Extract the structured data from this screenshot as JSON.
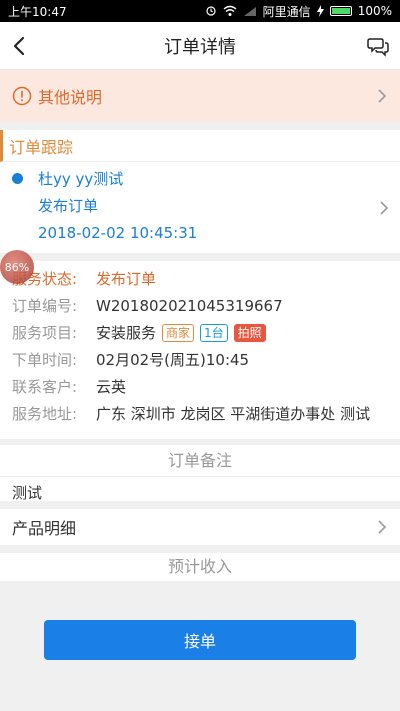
{
  "status_bar": {
    "time": "上午10:47",
    "carrier": "阿里通信",
    "battery": "100%",
    "battery_level": 1.0
  },
  "header": {
    "title": "订单详情"
  },
  "notice": {
    "label": "其他说明"
  },
  "tracking": {
    "section_title": "订单跟踪",
    "user": "杜yy yy测试",
    "event": "发布订单",
    "timestamp": "2018-02-02 10:45:31"
  },
  "overlay": {
    "percent": "86%"
  },
  "details": {
    "status_label": "服务状态:",
    "status_value": "发布订单",
    "order_no_label": "订单编号:",
    "order_no_value": "W201802021045319667",
    "service_label": "服务项目:",
    "service_value": "安装服务",
    "tags": [
      "商家",
      "1台",
      "拍照"
    ],
    "time_label": "下单时间:",
    "time_value": "02月02号(周五)10:45",
    "customer_label": "联系客户:",
    "customer_value": "云英",
    "address_label": "服务地址:",
    "address_value": "广东 深圳市 龙岗区 平湖街道办事处 测试"
  },
  "memo": {
    "title": "订单备注",
    "body": "测试"
  },
  "products": {
    "label": "产品明细"
  },
  "income": {
    "title": "预计收入"
  },
  "actions": {
    "accept_label": "接单"
  },
  "colors": {
    "accent_orange": "#e08a3c",
    "link_blue": "#1a7fd6",
    "button_blue": "#1a7fe6",
    "notice_bg": "#fde8e0"
  }
}
